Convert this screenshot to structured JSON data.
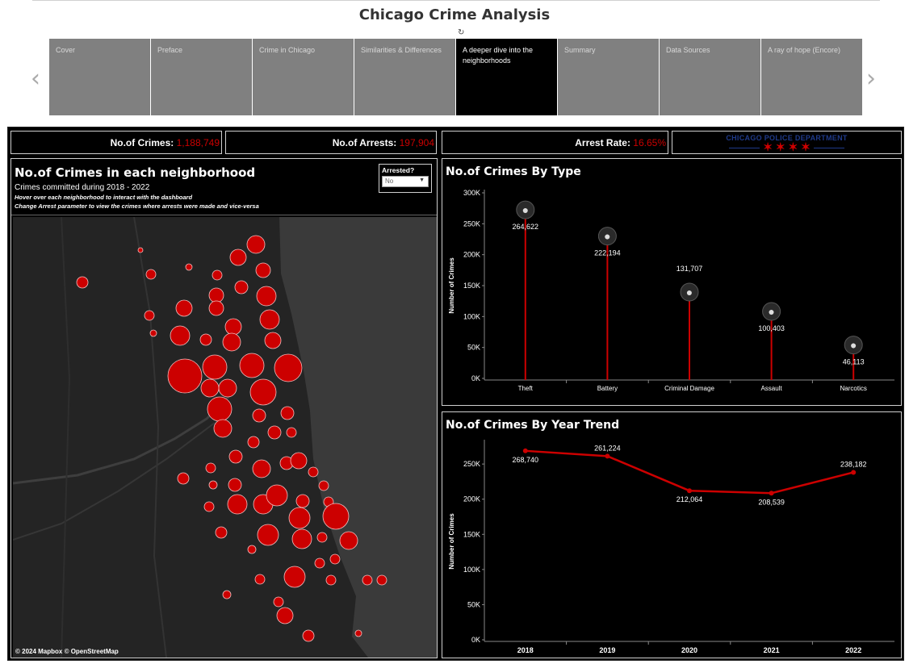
{
  "story": {
    "title": "Chicago Crime Analysis",
    "revert_icon": "revert-icon",
    "tabs": [
      {
        "label": "Cover",
        "active": false
      },
      {
        "label": "Preface",
        "active": false
      },
      {
        "label": "Crime in Chicago",
        "active": false
      },
      {
        "label": "Similarities & Differences",
        "active": false
      },
      {
        "label": "A deeper dive into the neighborhoods",
        "active": true
      },
      {
        "label": "Summary",
        "active": false
      },
      {
        "label": "Data Sources",
        "active": false
      },
      {
        "label": "A ray of hope (Encore)",
        "active": false
      }
    ],
    "prev_icon": "chevron-left-icon",
    "next_icon": "chevron-right-icon"
  },
  "kpis": {
    "crimes_label": "No.of Crimes:",
    "crimes_value": "1,188,749",
    "arrests_label": "No.of Arrests:",
    "arrests_value": "197,904",
    "rate_label": "Arrest Rate:",
    "rate_value": "16.65%",
    "logo_text": "CHICAGO POLICE DEPARTMENT",
    "logo_stars": "✶ ✶ ✶ ✶"
  },
  "map": {
    "title": "No.of Crimes in each neighborhood",
    "subtitle": "Crimes committed during 2018 - 2022",
    "note1": "Hover over each neighborhood to interact with the dashboard",
    "note2": "Change Arrest parameter to view the crimes where arrests were made and vice-versa",
    "param_label": "Arrested?",
    "param_value": "No",
    "credit": "© 2024 Mapbox  © OpenStreetMap",
    "bubble_color": "#cc0000",
    "land_color": "#242424",
    "water_color": "#3a3a3a"
  },
  "colors": {
    "accent": "#cc0000",
    "background": "#000000",
    "tab_inactive": "#808080",
    "tab_active": "#000000"
  },
  "chart_data": [
    {
      "type": "bar",
      "title": "No.of Crimes By Type",
      "ylabel": "Number of Crimes",
      "categories": [
        "Theft",
        "Battery",
        "Criminal Damage",
        "Assault",
        "Narcotics"
      ],
      "values": [
        264622,
        222194,
        131707,
        100403,
        46113
      ],
      "value_labels": [
        "264,622",
        "222,194",
        "131,707",
        "100,403",
        "46,113"
      ],
      "icons": [
        "thief-icon",
        "angry-man-icon",
        "burning-car-icon",
        "punch-icon",
        "pill-icon"
      ],
      "ylim": [
        0,
        300000
      ],
      "yticks": [
        "0K",
        "50K",
        "100K",
        "150K",
        "200K",
        "250K",
        "300K"
      ],
      "grid": false
    },
    {
      "type": "line",
      "title": "No.of Crimes By Year Trend",
      "ylabel": "Number of Crimes",
      "x": [
        "2018",
        "2019",
        "2020",
        "2021",
        "2022"
      ],
      "values": [
        268740,
        261224,
        212064,
        208539,
        238182
      ],
      "value_labels": [
        "268,740",
        "261,224",
        "212,064",
        "208,539",
        "238,182"
      ],
      "ylim": [
        0,
        270000
      ],
      "yticks": [
        "0K",
        "50K",
        "100K",
        "150K",
        "200K",
        "250K"
      ],
      "grid": false
    }
  ]
}
